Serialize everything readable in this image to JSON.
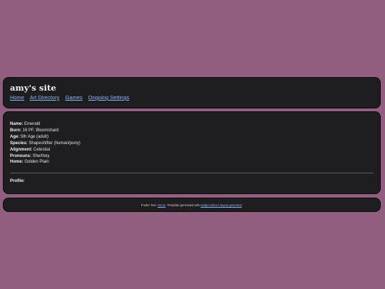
{
  "header": {
    "title": "amy's site",
    "nav": [
      "Home",
      "Art Directory",
      "Games",
      "Ongoing Settings"
    ]
  },
  "profile_info": [
    {
      "label": "Name:",
      "value": "Emerald"
    },
    {
      "label": "Born:",
      "value": "16 PF, Bloomshard"
    },
    {
      "label": "Age:",
      "value": "5th Age (adult)"
    },
    {
      "label": "Species:",
      "value": "Shapeshifter (human/pony)"
    },
    {
      "label": "Alignment:",
      "value": "Celestial"
    },
    {
      "label": "Pronouns:",
      "value": "She/they"
    },
    {
      "label": "Home:",
      "value": "Golden Plain"
    }
  ],
  "profile_heading": "Profile:",
  "footer": {
    "prefix": "Footer Text. ",
    "home_link": "Home",
    "middle": ". Template generated with ",
    "generator_link": "sadgrl.online's layout generator",
    "suffix": "."
  },
  "colors": {
    "background": "#915e80",
    "panel": "#1e1e20",
    "link": "#8ab4f8"
  }
}
